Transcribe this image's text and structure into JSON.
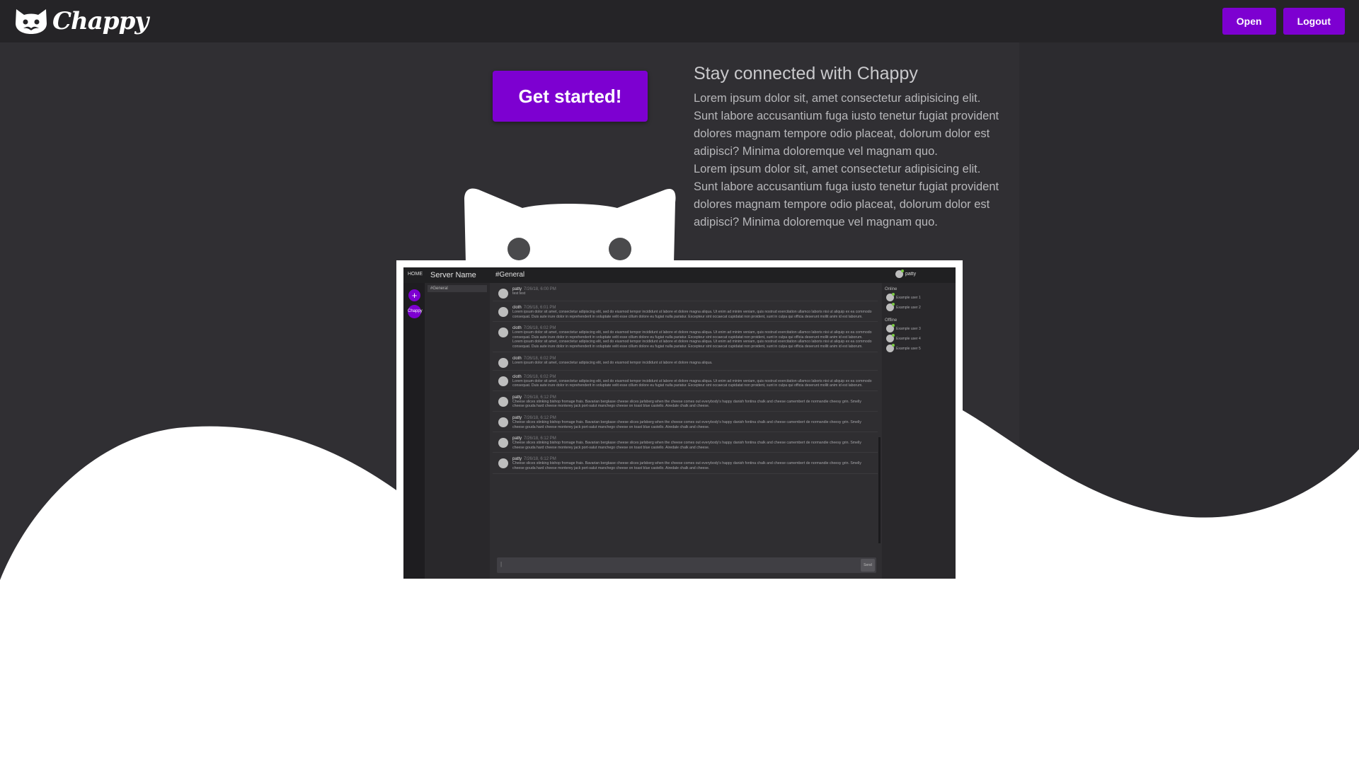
{
  "brand": {
    "name": "Chappy",
    "logo_icon": "cat-face-icon"
  },
  "nav": {
    "open_label": "Open",
    "logout_label": "Logout"
  },
  "colors": {
    "accent": "#7d00d1",
    "nav_bg": "#252427",
    "hero_bg": "#302f33",
    "wave": "#ffffff"
  },
  "hero": {
    "cta_label": "Get started!",
    "heading": "Stay connected with Chappy",
    "paragraphs": [
      "Lorem ipsum dolor sit, amet consectetur adipisicing elit. Sunt labore accusantium fuga iusto tenetur fugiat provident dolores magnam tempore odio placeat, dolorum dolor est adipisci? Minima doloremque vel magnam quo.",
      "Lorem ipsum dolor sit, amet consectetur adipisicing elit. Sunt labore accusantium fuga iusto tenetur fugiat provident dolores magnam tempore odio placeat, dolorum dolor est adipisci? Minima doloremque vel magnam quo."
    ]
  },
  "preview": {
    "home_label": "HOME",
    "server_name": "Server Name",
    "channel_title": "#General",
    "current_user": "patty",
    "rail": {
      "add_icon": "plus-icon",
      "server_label": "Chappy"
    },
    "channels": [
      "#General"
    ],
    "messages": [
      {
        "author": "patty",
        "time": "7/26/18, 6:00 PM",
        "text": "test test"
      },
      {
        "author": "cloth",
        "time": "7/26/18, 6:01 PM",
        "text": "Lorem ipsum dolor sit amet, consectetur adipiscing elit, sed do eiusmod tempor incididunt ut labore et dolore magna aliqua. Ut enim ad minim veniam, quis nostrud exercitation ullamco laboris nisi ut aliquip ex ea commodo consequat. Duis aute irure dolor in reprehenderit in voluptate velit esse cillum dolore eu fugiat nulla pariatur. Excepteur sint occaecat cupidatat non proident, sunt in culpa qui officia deserunt mollit anim id est laborum."
      },
      {
        "author": "cloth",
        "time": "7/26/18, 6:02 PM",
        "text": "Lorem ipsum dolor sit amet, consectetur adipiscing elit, sed do eiusmod tempor incididunt ut labore et dolore magna aliqua. Ut enim ad minim veniam, quis nostrud exercitation ullamco laboris nisi ut aliquip ex ea commodo consequat. Duis aute irure dolor in reprehenderit in voluptate velit esse cillum dolore eu fugiat nulla pariatur. Excepteur sint occaecat cupidatat non proident, sunt in culpa qui officia deserunt mollit anim id est laborum. Lorem ipsum dolor sit amet, consectetur adipiscing elit, sed do eiusmod tempor incididunt ut labore et dolore magna aliqua. Ut enim ad minim veniam, quis nostrud exercitation ullamco laboris nisi ut aliquip ex ea commodo consequat. Duis aute irure dolor in reprehenderit in voluptate velit esse cillum dolore eu fugiat nulla pariatur. Excepteur sint occaecat cupidatat non proident, sunt in culpa qui officia deserunt mollit anim id est laborum."
      },
      {
        "author": "cloth",
        "time": "7/26/18, 6:02 PM",
        "text": "Lorem ipsum dolor sit amet, consectetur adipiscing elit, sed do eiusmod tempor incididunt ut labore et dolore magna aliqua."
      },
      {
        "author": "cloth",
        "time": "7/26/18, 6:02 PM",
        "text": "Lorem ipsum dolor sit amet, consectetur adipiscing elit, sed do eiusmod tempor incididunt ut labore et dolore magna aliqua. Ut enim ad minim veniam, quis nostrud exercitation ullamco laboris nisi ut aliquip ex ea commodo consequat. Duis aute irure dolor in reprehenderit in voluptate velit esse cillum dolore eu fugiat nulla pariatur. Excepteur sint occaecat cupidatat non proident, sunt in culpa qui officia deserunt mollit anim id est laborum."
      },
      {
        "author": "patty",
        "time": "7/26/18, 6:12 PM",
        "text": "Cheese slices stinking bishop fromage frais. Bavarian bergkase cheese slices jarlsberg when the cheese comes out everybody's happy danish fontina chalk and cheese camembert de normandie cheesy grin. Smelly cheese gouda hard cheese monterey jack port-salut manchego cheese on toast blue castello. Airedale chalk and cheese."
      },
      {
        "author": "patty",
        "time": "7/26/18, 6:12 PM",
        "text": "Cheese slices stinking bishop fromage frais. Bavarian bergkase cheese slices jarlsberg when the cheese comes out everybody's happy danish fontina chalk and cheese camembert de normandie cheesy grin. Smelly cheese gouda hard cheese monterey jack port-salut manchego cheese on toast blue castello. Airedale chalk and cheese."
      },
      {
        "author": "patty",
        "time": "7/26/18, 6:12 PM",
        "text": "Cheese slices stinking bishop fromage frais. Bavarian bergkase cheese slices jarlsberg when the cheese comes out everybody's happy danish fontina chalk and cheese camembert de normandie cheesy grin. Smelly cheese gouda hard cheese monterey jack port-salut manchego cheese on toast blue castello. Airedale chalk and cheese."
      },
      {
        "author": "patty",
        "time": "7/26/18, 6:12 PM",
        "text": "Cheese slices stinking bishop fromage frais. Bavarian bergkase cheese slices jarlsberg when the cheese comes out everybody's happy danish fontina chalk and cheese camembert de normandie cheesy grin. Smelly cheese gouda hard cheese monterey jack port-salut manchego cheese on toast blue castello. Airedale chalk and cheese."
      }
    ],
    "input_value": "|",
    "send_label": "Send",
    "members": {
      "online_heading": "Online",
      "online": [
        "Example user 1",
        "Example user 2"
      ],
      "offline_heading": "Offline",
      "offline": [
        "Example user 3",
        "Example user 4",
        "Example user 5"
      ]
    }
  }
}
